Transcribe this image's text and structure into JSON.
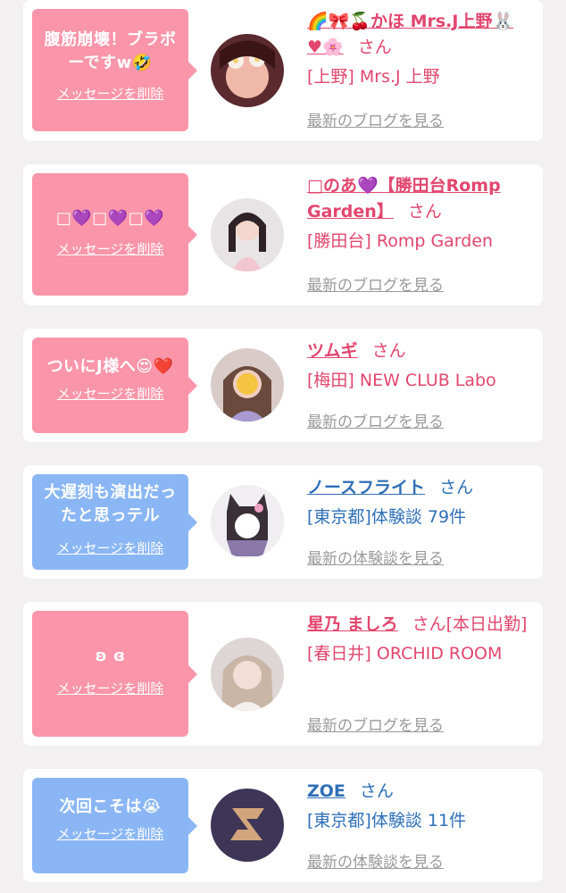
{
  "cards": [
    {
      "message": "腹筋崩壊！ブラボーですw🤣",
      "delete_label": "メッセージを削除",
      "name": "🌈🎀🍒かほ Mrs.J上野🐰♥🌸",
      "honorific": "さん",
      "store": "[上野] Mrs.J 上野",
      "link": "最新のブログを見る",
      "bubble_color": "#fb95a9"
    },
    {
      "message": "□💜□💜□💜",
      "delete_label": "メッセージを削除",
      "name": "□のあ💜【勝田台Romp Garden】",
      "honorific": "さん",
      "store": "[勝田台] Romp Garden",
      "link": "最新のブログを見る",
      "bubble_color": "#fb95a9"
    },
    {
      "message": "ついにJ様へ😍❤️",
      "delete_label": "メッセージを削除",
      "name": "ツムギ",
      "honorific": "さん",
      "store": "[梅田] NEW CLUB Labo",
      "link": "最新のブログを見る",
      "bubble_color": "#fb95a9"
    },
    {
      "message": "大遅刻も演出だったと思っテル",
      "delete_label": "メッセージを削除",
      "name": "ノースフライト",
      "honorific": "さん",
      "store": "[東京都]体験談 79件",
      "link": "最新の体験談を見る",
      "bubble_color": "#8ab6f5"
    },
    {
      "message": "ʚ ɞ",
      "delete_label": "メッセージを削除",
      "name": "星乃 ましろ",
      "honorific": "さん[本日出勤]",
      "store": "[春日井] ORCHID ROOM",
      "link": "最新のブログを見る",
      "bubble_color": "#fb95a9"
    },
    {
      "message": "次回こそは😭",
      "delete_label": "メッセージを削除",
      "name": "ZOE",
      "honorific": "さん",
      "store": "[東京都]体験談 11件",
      "link": "最新の体験談を見る",
      "bubble_color": "#8ab6f5"
    }
  ]
}
